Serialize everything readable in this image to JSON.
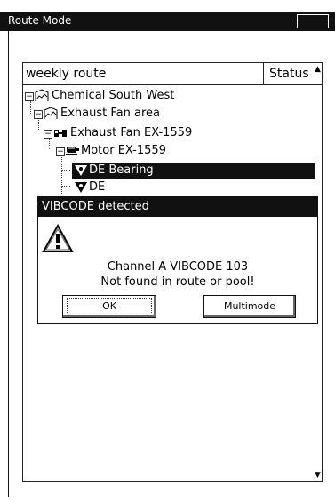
{
  "window": {
    "title": "Route Mode"
  },
  "route_list": {
    "column_name": "weekly route",
    "column_status": "Status",
    "items": [
      {
        "label": "Chemical South West",
        "icon": "area-icon"
      },
      {
        "label": "Exhaust Fan area",
        "icon": "area-icon"
      },
      {
        "label": "Exhaust Fan EX-1559",
        "icon": "machine-icon"
      },
      {
        "label": "Motor EX-1559",
        "icon": "motor-icon"
      },
      {
        "label": "DE Bearing",
        "icon": "measurement-point-icon",
        "selected": true
      },
      {
        "label": "DE",
        "icon": "measurement-point-icon"
      }
    ],
    "expander_symbol": "⊟"
  },
  "dialog": {
    "title": "VIBCODE detected",
    "icon": "warning-icon",
    "message_line1": "Channel A VIBCODE 103",
    "message_line2": "Not found in route or pool!",
    "ok_label": "OK",
    "multimode_label": "Multimode"
  },
  "colors": {
    "titlebar_bg": "#111111",
    "selection_bg": "#111111",
    "background": "#ffffff"
  }
}
